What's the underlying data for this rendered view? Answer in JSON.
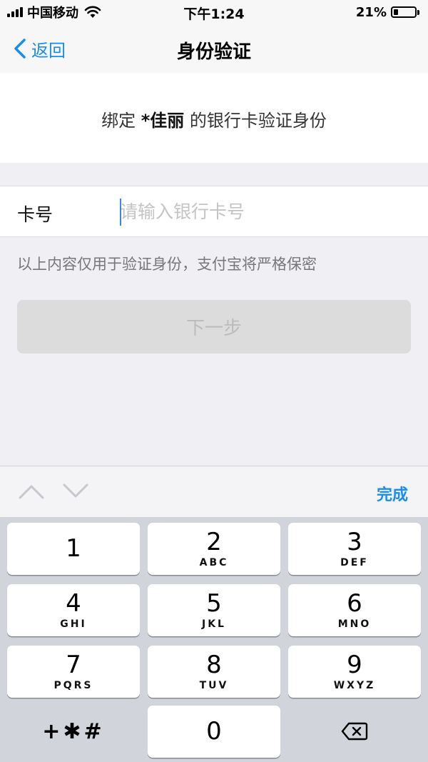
{
  "status_bar": {
    "carrier": "中国移动",
    "time": "下午1:24",
    "battery_percent": "21%",
    "battery_level": 0.21
  },
  "nav": {
    "back_label": "返回",
    "title": "身份验证"
  },
  "intro": {
    "prefix": "绑定 ",
    "name": "*佳丽",
    "suffix": " 的银行卡验证身份"
  },
  "form": {
    "card_label": "卡号",
    "card_placeholder": "请输入银行卡号",
    "card_value": ""
  },
  "hint": "以上内容仅用于验证身份，支付宝将严格保密",
  "next_button": "下一步",
  "accessory": {
    "done_label": "完成"
  },
  "keypad": {
    "keys": [
      {
        "num": "1",
        "letters": ""
      },
      {
        "num": "2",
        "letters": "ABC"
      },
      {
        "num": "3",
        "letters": "DEF"
      },
      {
        "num": "4",
        "letters": "GHI"
      },
      {
        "num": "5",
        "letters": "JKL"
      },
      {
        "num": "6",
        "letters": "MNO"
      },
      {
        "num": "7",
        "letters": "PQRS"
      },
      {
        "num": "8",
        "letters": "TUV"
      },
      {
        "num": "9",
        "letters": "WXYZ"
      }
    ],
    "symbols": "+✱#",
    "zero": "0",
    "delete_icon": "backspace-icon"
  },
  "colors": {
    "accent": "#1a8cf0",
    "caret": "#3b82f6",
    "disabled_button": "#dcdcdc"
  }
}
